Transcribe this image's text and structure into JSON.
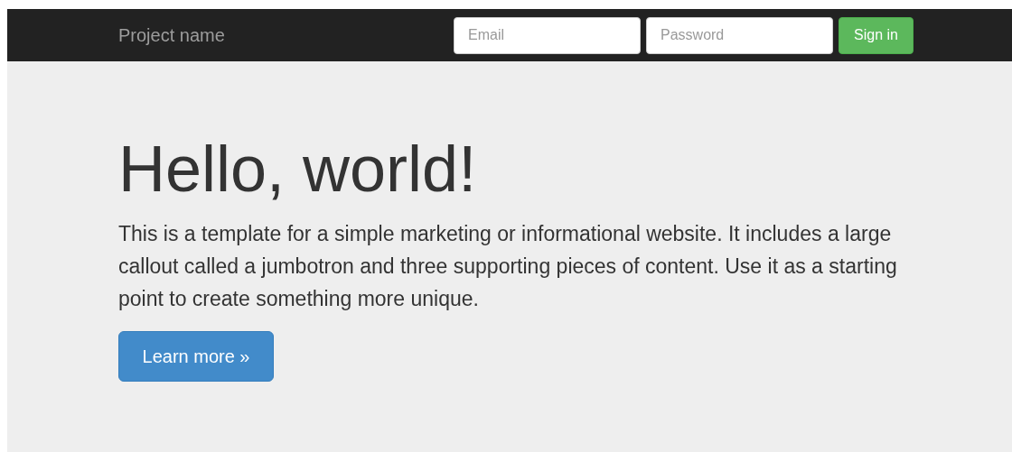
{
  "navbar": {
    "brand": "Project name",
    "email": {
      "placeholder": "Email"
    },
    "password": {
      "placeholder": "Password"
    },
    "sign_in_button": "Sign in"
  },
  "jumbotron": {
    "heading": "Hello, world!",
    "text": "This is a template for a simple marketing or informational website. It includes a large callout called a jumbotron and three supporting pieces of content. Use it as a starting point to create something more unique.",
    "button": "Learn more »"
  }
}
